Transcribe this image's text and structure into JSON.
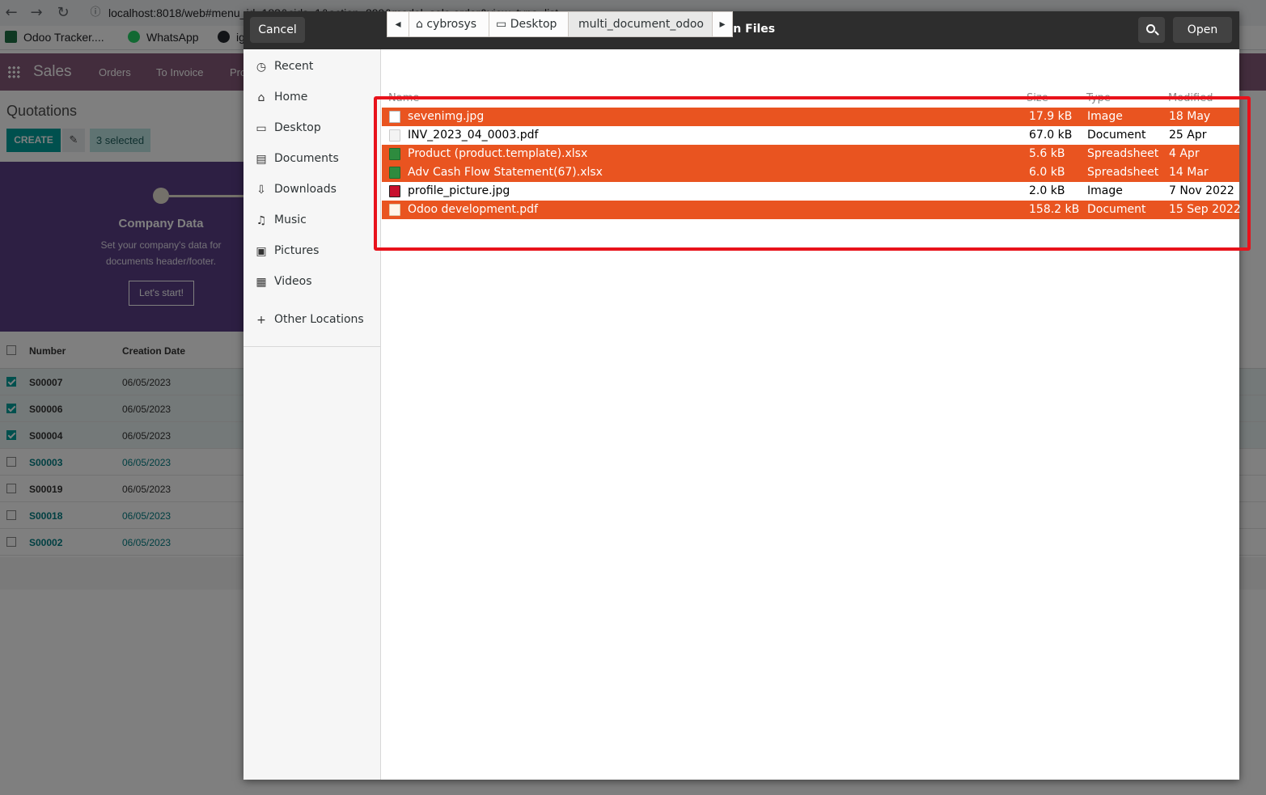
{
  "browser": {
    "url": "localhost:8018/web#menu_id=183&cids=1&action=299&model=sale.order&view_type=list",
    "bookmarks": [
      {
        "label": "Odoo Tracker...."
      },
      {
        "label": "WhatsApp"
      },
      {
        "label": "ig"
      }
    ]
  },
  "odoo": {
    "app_name": "Sales",
    "menu": [
      "Orders",
      "To Invoice",
      "Pro"
    ],
    "page_title": "Quotations",
    "create_label": "CREATE",
    "selected_label": "3 selected",
    "banner": {
      "title": "Company Data",
      "text": "Set your company's data for documents header/footer.",
      "button": "Let's start!"
    },
    "columns": {
      "number": "Number",
      "creation_date": "Creation Date"
    },
    "rows": [
      {
        "number": "S00007",
        "date": "06/05/2023",
        "checked": true
      },
      {
        "number": "S00006",
        "date": "06/05/2023",
        "checked": true
      },
      {
        "number": "S00004",
        "date": "06/05/2023",
        "checked": true
      },
      {
        "number": "S00003",
        "date": "06/05/2023",
        "checked": false
      },
      {
        "number": "S00019",
        "date": "06/05/2023",
        "checked": false
      },
      {
        "number": "S00018",
        "date": "06/05/2023",
        "checked": false
      },
      {
        "number": "S00002",
        "date": "06/05/2023",
        "checked": false
      }
    ]
  },
  "dialog": {
    "title": "Open Files",
    "cancel_label": "Cancel",
    "open_label": "Open",
    "sidebar": [
      {
        "label": "Recent",
        "icon": "clock-icon"
      },
      {
        "label": "Home",
        "icon": "home-icon"
      },
      {
        "label": "Desktop",
        "icon": "desktop-icon"
      },
      {
        "label": "Documents",
        "icon": "document-icon"
      },
      {
        "label": "Downloads",
        "icon": "download-icon"
      },
      {
        "label": "Music",
        "icon": "music-icon"
      },
      {
        "label": "Pictures",
        "icon": "picture-icon"
      },
      {
        "label": "Videos",
        "icon": "video-icon"
      }
    ],
    "other_locations": "Other Locations",
    "path": [
      "cybrosys",
      "Desktop",
      "multi_document_odoo"
    ],
    "columns": {
      "name": "Name",
      "size": "Size",
      "type": "Type",
      "modified": "Modified"
    },
    "files": [
      {
        "name": "sevenimg.jpg",
        "size": "17.9 kB",
        "type": "Image",
        "modified": "18 May",
        "selected": true,
        "icon": "image-file-icon"
      },
      {
        "name": "INV_2023_04_0003.pdf",
        "size": "67.0 kB",
        "type": "Document",
        "modified": "25 Apr",
        "selected": false,
        "icon": "pdf-file-icon"
      },
      {
        "name": "Product (product.template).xlsx",
        "size": "5.6 kB",
        "type": "Spreadsheet",
        "modified": "4 Apr",
        "selected": true,
        "icon": "spreadsheet-file-icon"
      },
      {
        "name": "Adv Cash Flow Statement(67).xlsx",
        "size": "6.0 kB",
        "type": "Spreadsheet",
        "modified": "14 Mar",
        "selected": true,
        "icon": "spreadsheet-file-icon"
      },
      {
        "name": "profile_picture.jpg",
        "size": "2.0 kB",
        "type": "Image",
        "modified": "7 Nov 2022",
        "selected": false,
        "icon": "image-file-icon"
      },
      {
        "name": "Odoo development.pdf",
        "size": "158.2 kB",
        "type": "Document",
        "modified": "15 Sep 2022",
        "selected": true,
        "icon": "pdf-file-icon"
      }
    ],
    "colors": {
      "selection": "#e95420",
      "highlight_box": "#e8121b",
      "headerbar": "#2d2d2d"
    }
  }
}
